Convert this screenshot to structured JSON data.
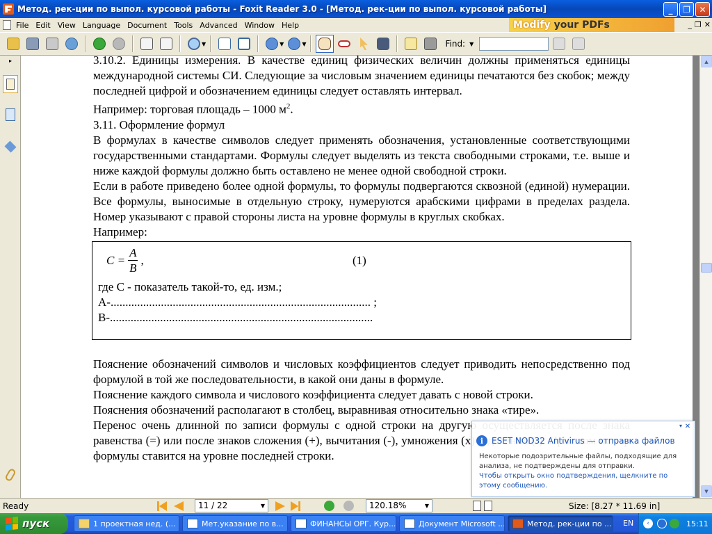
{
  "window": {
    "title": "Метод. рек-ции по выпол. курсовой работы - Foxit Reader 3.0 - [Метод. рек-ции по выпол. курсовой работы]",
    "minimize": "_",
    "maximize": "❐",
    "close": "✕"
  },
  "menu": {
    "items": [
      "File",
      "Edit",
      "View",
      "Language",
      "Document",
      "Tools",
      "Advanced",
      "Window",
      "Help"
    ],
    "promo_modify": "Modify",
    "promo_rest": "your PDFs",
    "ctrl": [
      "_",
      "❐",
      "✕"
    ]
  },
  "toolbar": {
    "find_label": "Find:",
    "find_value": ""
  },
  "document": {
    "paragraphs": [
      "3.10.2.  Единицы измерения. В качестве единиц физических величин должны применяться единицы международной системы СИ. Следующие за числовым значением единицы печатаются без скобок; между последней цифрой и обозначением единицы следует оставлять интервал.",
      "Например: торговая площадь – 1000 м",
      "3.11.    Оформление формул",
      "В формулах в качестве символов следует применять обозначения, установленные соответствующими государственными стандартами. Формулы следует выделять из текста свободными строками, т.е. выше и ниже каждой формулы должно быть оставлено не менее одной свободной строки.",
      "Если в работе приведено более одной формулы, то формулы подвергаются сквозной (единой) нумерации. Все формулы, выносимые в отдельную строку, нумеруются арабскими цифрами в пределах раздела. Номер указывают с правой стороны листа на уровне формулы в круглых скобках.",
      "Например:"
    ],
    "superscript": "2",
    "example_suffix": ".",
    "formula": {
      "lhs": "C =",
      "numerator": "A",
      "denominator": "B",
      "comma": ",",
      "number": "(1)",
      "line1": "где    С - показатель такой-то, ед. изм.;",
      "line2": "А-........................................................................................ ;",
      "line3": "В-........................................................................................."
    },
    "after": [
      "Пояснение обозначений символов и числовых коэффициентов следует приводить непосредственно под формулой в той же последовательности, в какой они даны в формуле.",
      "Пояснение каждого символа и числового коэффициента следует давать с новой строки.",
      "Пояснения обозначений располагают в столбец, выравнивая относительно знака «тире».",
      "Перенос очень длинной по записи формулы с одной строки на другую осуществляется после знака равенства (=) или после знаков сложения (+), вычитания (-), умножения (х) и деления (:). При этом номер формулы ставится на уровне последней строки."
    ]
  },
  "statusbar": {
    "ready": "Ready",
    "page": "11 / 22",
    "zoom": "120.18%",
    "size": "Size: [8.27 * 11.69 in]"
  },
  "balloon": {
    "title": "ESET NOD32 Antivirus — отправка файлов",
    "body": "Некоторые подозрительные файлы, подходящие для анализа, не подтверждены для отправки.",
    "link": "Чтобы открыть окно подтверждения, щелкните по этому сообщению.",
    "close": "✕",
    "options": "▾"
  },
  "taskbar": {
    "start": "пуск",
    "tasks": [
      "1 проектная нед. (...",
      "Мет.указание по в...",
      "ФИНАНСЫ ОРГ. Кур...",
      "Документ Microsoft ...",
      "Метод. рек-ции по ..."
    ],
    "lang": "EN",
    "clock": "15:11"
  },
  "colors": {
    "titlebar": "#0a5fe0",
    "taskbar": "#245edb",
    "start": "#36993c"
  }
}
